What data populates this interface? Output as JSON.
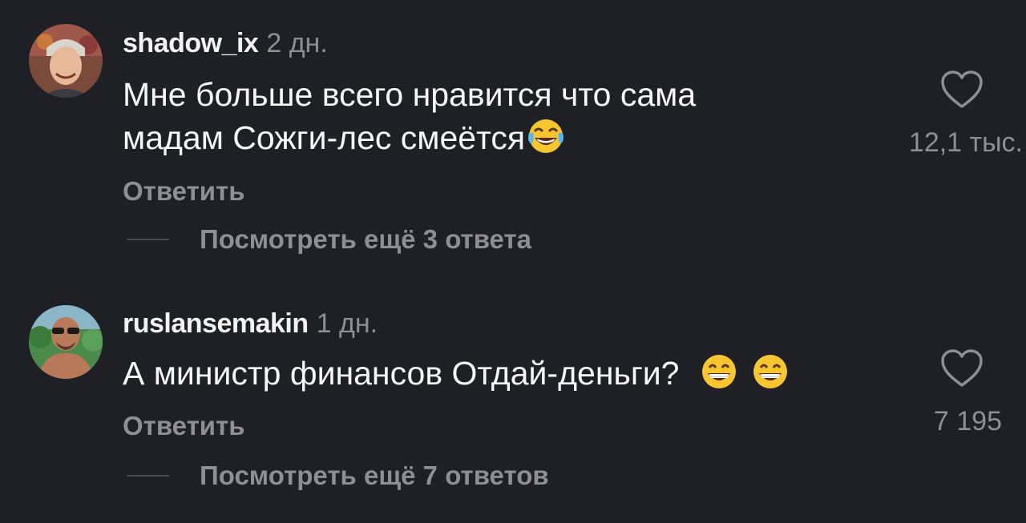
{
  "comments": [
    {
      "username": "shadow_ix",
      "age": "2 дн.",
      "text_lines": [
        "Мне больше всего нравится что сама",
        "мадам Сожги-лес смеётся"
      ],
      "emoji": [
        "face-with-tears-of-joy"
      ],
      "reply_label": "Ответить",
      "more_replies": "Посмотреть ещё 3 ответа",
      "like_count": "12,1 тыс."
    },
    {
      "username": "ruslansemakin",
      "age": "1 дн.",
      "text_lines": [
        "А министр финансов Отдай-деньги?"
      ],
      "emoji": [
        "grinning-face-with-smiling-eyes",
        "grinning-face-with-smiling-eyes"
      ],
      "reply_label": "Ответить",
      "more_replies": "Посмотреть ещё 7 ответов",
      "like_count": "7 195"
    }
  ],
  "colors": {
    "background": "#1f1f26",
    "primary_text": "#f7f7f7",
    "secondary_text": "#8e8e93"
  }
}
